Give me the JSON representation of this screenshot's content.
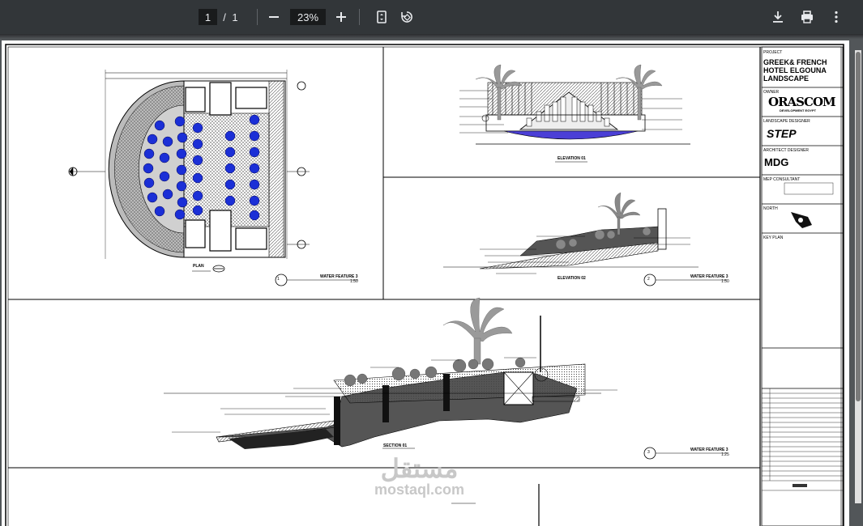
{
  "toolbar": {
    "page_current": "1",
    "page_separator": "/",
    "page_total": "1",
    "zoom": "23%",
    "icons": [
      "zoom-out-icon",
      "zoom-in-icon",
      "fit-page-icon",
      "rotate-icon",
      "download-icon",
      "print-icon",
      "more-icon"
    ]
  },
  "titleblock": {
    "project_label": "PROJECT",
    "project_name": "GREEK& FRENCH HOTEL ELGOUNA LANDSCAPE",
    "owner_label": "OWNER",
    "owner_logo": "ORASCOM",
    "owner_sub": "DEVELOPMENT EGYPT",
    "landscape_label": "LANDSCAPE DESIGNER",
    "landscape_logo": "STEP",
    "architect_label": "ARCHITECT DESIGNER",
    "architect_logo": "MDG",
    "mep_label": "MEP CONSULTANT",
    "north_label": "NORTH",
    "keyplan_label": "KEY PLAN"
  },
  "drawings": {
    "plan_label": "PLAN",
    "wf1_title": "WATER FEATURE 3",
    "wf1_num": "1",
    "wf1_scale": "1:50",
    "elev1_label": "ELEVATION 01",
    "elev2_label": "ELEVATION 02",
    "wf2_title": "WATER FEATURE 3",
    "wf2_num": "2",
    "wf2_scale": "1:50",
    "section_label": "SECTION 01",
    "wf3_title": "WATER FEATURE 3",
    "wf3_num": "3",
    "wf3_scale": "1:25"
  },
  "watermark": {
    "arabic": "مستقل",
    "latin": "mostaql.com"
  },
  "colors": {
    "toolbar_bg": "#323639",
    "viewer_bg": "#525659",
    "water_blue": "#1b2fd6"
  }
}
